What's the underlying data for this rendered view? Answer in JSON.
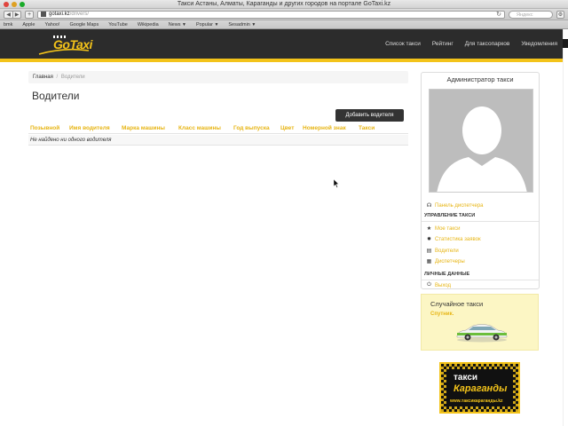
{
  "browser": {
    "window_title": "Такси Астаны, Алматы, Караганды и других городов на портале GoTaxi.kz",
    "url_host": "gotaxi.kz",
    "url_path": "/drivers/",
    "search_placeholder": "Яндекс",
    "bookmarks": [
      "Apple",
      "Yahoo!",
      "Google Maps",
      "YouTube",
      "Wikipedia",
      "News",
      "Popular",
      "Sesadmin"
    ],
    "bookmarks_icon_label": "bmk"
  },
  "site": {
    "logo_text": "GoTaxi",
    "nav": [
      "Список такси",
      "Рейтинг",
      "Для таксопарков",
      "Уведомления"
    ]
  },
  "breadcrumb": {
    "home": "Главная",
    "separator": "/",
    "current": "Водители"
  },
  "page": {
    "title": "Водители",
    "add_button": "Добавить водителя"
  },
  "table": {
    "columns": [
      "Позывной",
      "Имя водителя",
      "Марка машины",
      "Класс машины",
      "Год выпуска",
      "Цвет",
      "Номерной знак",
      "Такси"
    ],
    "empty_message": "Не найдено ни одного водителя"
  },
  "sidebar": {
    "title": "Администратор такси",
    "dispatcher_panel": "Панель диспетчера",
    "section_manage": "УПРАВЛЕНИЕ ТАКСИ",
    "manage_items": [
      "Мое такси",
      "Статистика заявок",
      "Водители",
      "Диспетчеры"
    ],
    "section_personal": "ЛИЧНЫЕ ДАННЫЕ",
    "logout": "Выход"
  },
  "random_taxi": {
    "title": "Случайное такси",
    "name": "Спутник."
  },
  "ad": {
    "line1": "такси",
    "line2": "Караганды",
    "line3": "www.таксикараганды.kz"
  },
  "colors": {
    "accent": "#f3c31a",
    "link": "#e7b514",
    "header_bg": "#2c2c2c"
  }
}
